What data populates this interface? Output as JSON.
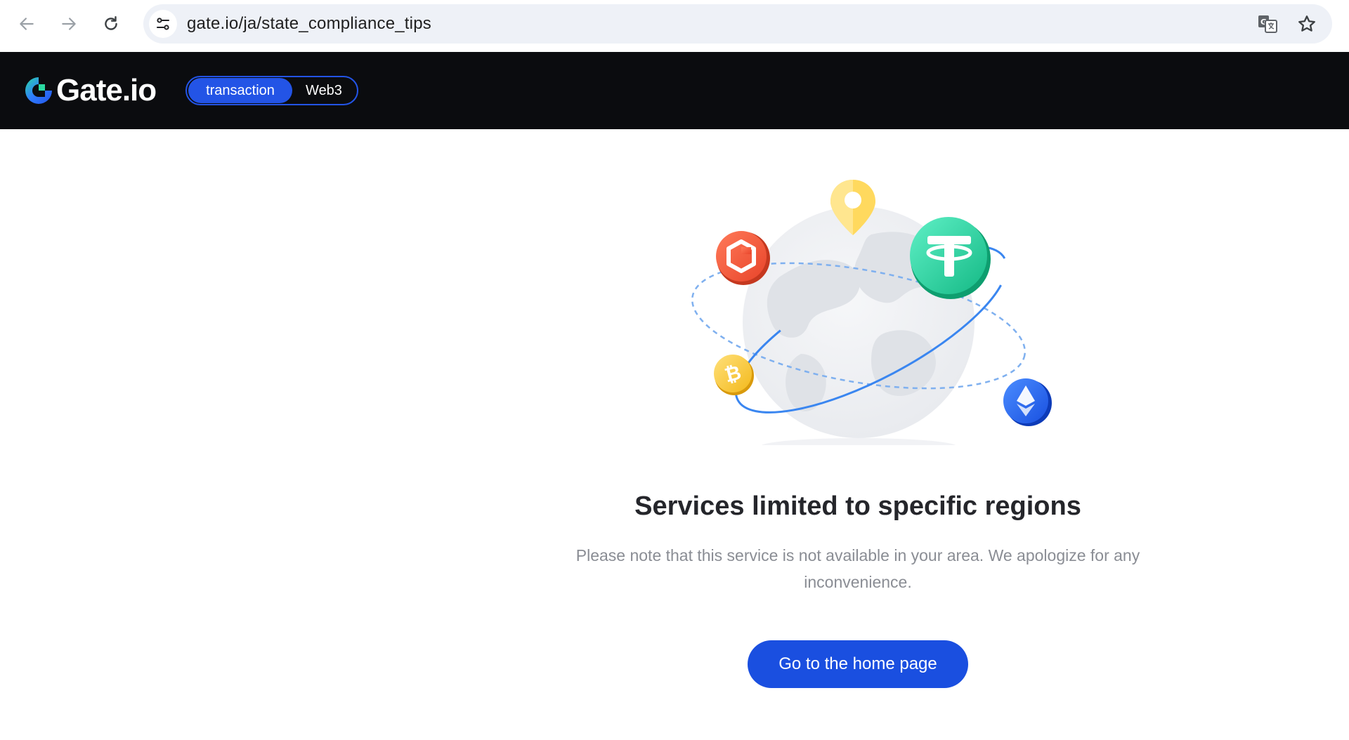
{
  "browser": {
    "url": "gate.io/ja/state_compliance_tips",
    "back_icon": "arrow-left-icon",
    "forward_icon": "arrow-right-icon",
    "reload_icon": "reload-icon",
    "site_info_icon": "tune-icon",
    "translate_icon": "translate-icon",
    "bookmark_icon": "star-icon"
  },
  "header": {
    "logo_text": "Gate.io",
    "modes": [
      {
        "label": "transaction",
        "active": true
      },
      {
        "label": "Web3",
        "active": false
      }
    ],
    "brand_color": "#2354e6"
  },
  "main": {
    "title": "Services limited to specific regions",
    "message": "Please note that this service is not available in your area. We apologize for any inconvenience.",
    "cta_label": "Go to the home page",
    "cta_color": "#1a4fe0"
  }
}
